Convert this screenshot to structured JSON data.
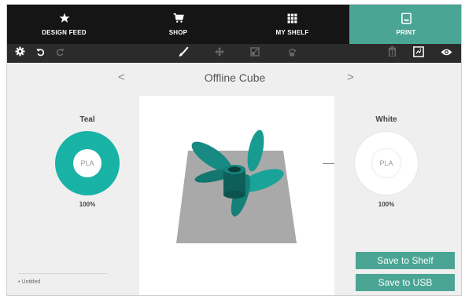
{
  "nav": {
    "tabs": [
      {
        "label": "DESIGN FEED",
        "icon": "star-icon"
      },
      {
        "label": "SHOP",
        "icon": "cart-icon"
      },
      {
        "label": "MY SHELF",
        "icon": "grid-icon"
      },
      {
        "label": "PRINT",
        "icon": "printer-icon",
        "active": true
      }
    ]
  },
  "toolbar": {
    "left": [
      "gear-icon",
      "undo-icon",
      "redo-icon"
    ],
    "center": [
      "brush-icon",
      "move-icon",
      "scale-icon",
      "rotate-icon"
    ],
    "right": [
      "trash-icon",
      "layout-icon",
      "eye-icon"
    ]
  },
  "model": {
    "title": "Offline Cube",
    "prev_arrow": "<",
    "next_arrow": ">"
  },
  "materials": {
    "left": {
      "name": "Teal",
      "type": "PLA",
      "percent": "100%",
      "color": "#19b3a6"
    },
    "right": {
      "name": "White",
      "type": "PLA",
      "percent": "100%",
      "color": "#ffffff"
    }
  },
  "actions": {
    "save_shelf": "Save to Shelf",
    "save_usb": "Save to USB"
  },
  "files": {
    "recent": "Untitled"
  },
  "colors": {
    "accent": "#4aa594",
    "nav_bg": "#151515",
    "toolbar_bg": "#2b2b2b",
    "model_teal": "#178c84",
    "plate": "#a9a9a9"
  }
}
